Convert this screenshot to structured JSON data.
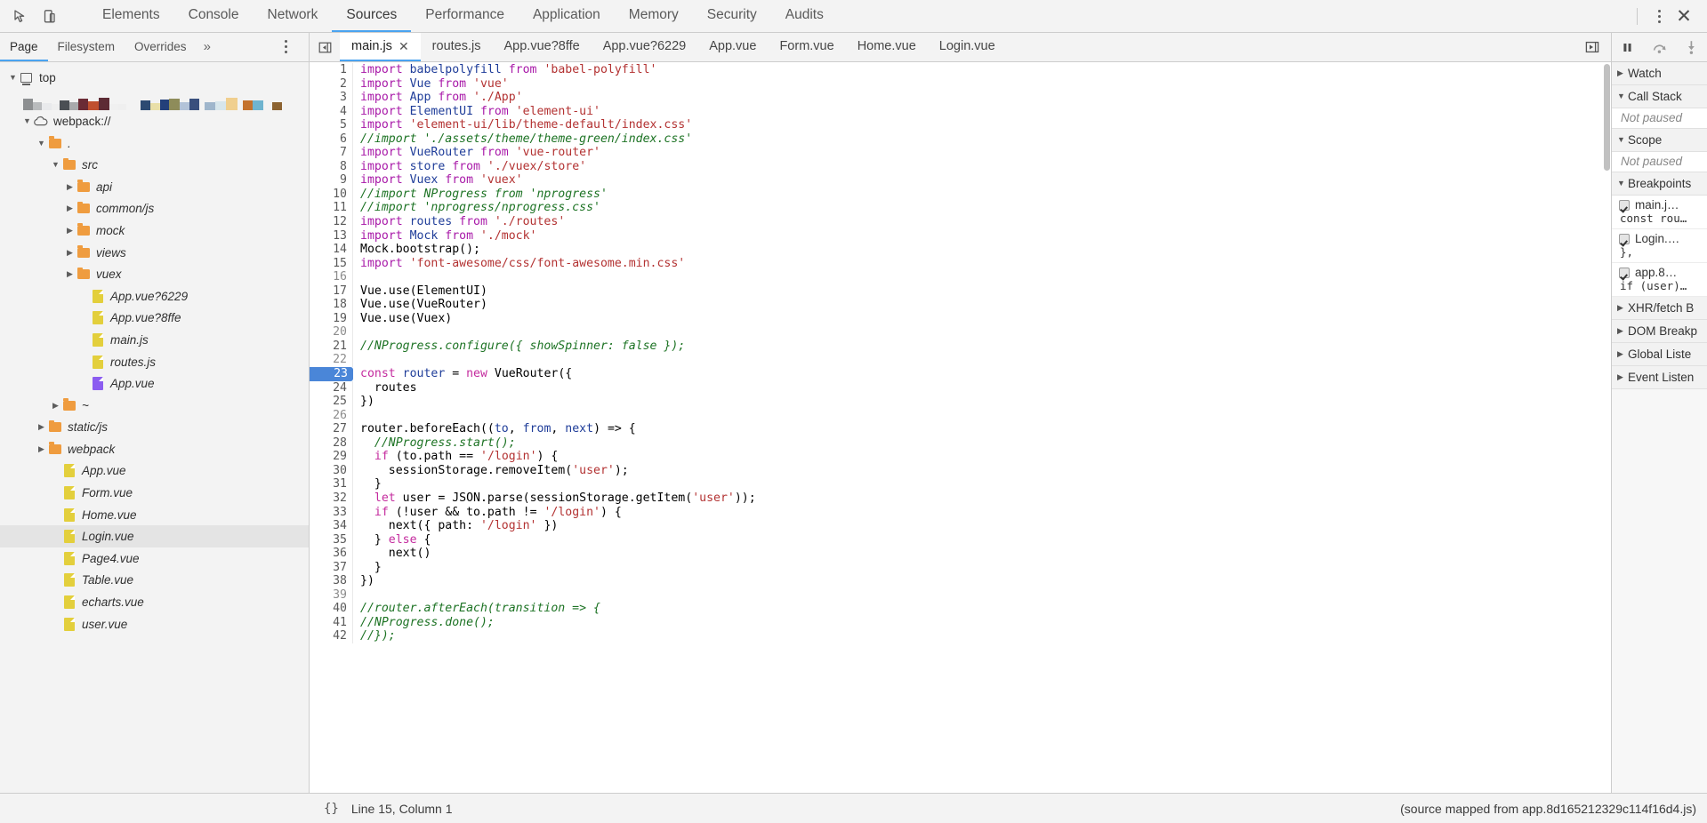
{
  "toolbar": {
    "inspect_icon": "inspect-cursor-icon",
    "device_icon": "device-toggle-icon",
    "tabs": [
      {
        "label": "Elements",
        "active": false
      },
      {
        "label": "Console",
        "active": false
      },
      {
        "label": "Network",
        "active": false
      },
      {
        "label": "Sources",
        "active": true
      },
      {
        "label": "Performance",
        "active": false
      },
      {
        "label": "Application",
        "active": false
      },
      {
        "label": "Memory",
        "active": false
      },
      {
        "label": "Security",
        "active": false
      },
      {
        "label": "Audits",
        "active": false
      }
    ],
    "more_label": "⋮",
    "close_label": "✕"
  },
  "nav_header": {
    "tabs": [
      {
        "label": "Page",
        "active": true
      },
      {
        "label": "Filesystem",
        "active": false
      },
      {
        "label": "Overrides",
        "active": false
      },
      {
        "label": "»",
        "active": false
      }
    ],
    "more_label": "⋮"
  },
  "editor_tabs": [
    {
      "label": "main.js",
      "active": true,
      "closable": true,
      "close_label": "✕"
    },
    {
      "label": "routes.js",
      "active": false,
      "closable": false
    },
    {
      "label": "App.vue?8ffe",
      "active": false,
      "closable": false
    },
    {
      "label": "App.vue?6229",
      "active": false,
      "closable": false
    },
    {
      "label": "App.vue",
      "active": false,
      "closable": false
    },
    {
      "label": "Form.vue",
      "active": false,
      "closable": false
    },
    {
      "label": "Home.vue",
      "active": false,
      "closable": false
    },
    {
      "label": "Login.vue",
      "active": false,
      "closable": false
    }
  ],
  "editor_tabbar_actions": {
    "show_navigator_icon": "show-navigator-icon"
  },
  "debug_toolbar": {
    "pause_icon": "pause-resume-icon",
    "step_over_icon": "step-over-icon",
    "step_into_icon": "step-into-icon"
  },
  "sidebar": {
    "items": [
      {
        "label": "top",
        "icon": "frame-icon",
        "twisty": "▼",
        "indent": 0,
        "italic": false,
        "selected": false
      },
      {
        "label": "",
        "icon": "favicon-mosaic",
        "twisty": "",
        "indent": 1,
        "italic": false,
        "selected": false,
        "mosaic": true
      },
      {
        "label": "webpack://",
        "icon": "cloud-icon",
        "twisty": "▼",
        "indent": 1,
        "italic": false,
        "selected": false
      },
      {
        "label": ".",
        "icon": "folder-icon",
        "twisty": "▼",
        "indent": 2,
        "italic": true,
        "selected": false
      },
      {
        "label": "src",
        "icon": "folder-icon",
        "twisty": "▼",
        "indent": 3,
        "italic": true,
        "selected": false
      },
      {
        "label": "api",
        "icon": "folder-icon",
        "twisty": "▶",
        "indent": 4,
        "italic": true,
        "selected": false
      },
      {
        "label": "common/js",
        "icon": "folder-icon",
        "twisty": "▶",
        "indent": 4,
        "italic": true,
        "selected": false
      },
      {
        "label": "mock",
        "icon": "folder-icon",
        "twisty": "▶",
        "indent": 4,
        "italic": true,
        "selected": false
      },
      {
        "label": "views",
        "icon": "folder-icon",
        "twisty": "▶",
        "indent": 4,
        "italic": true,
        "selected": false
      },
      {
        "label": "vuex",
        "icon": "folder-icon",
        "twisty": "▶",
        "indent": 4,
        "italic": true,
        "selected": false
      },
      {
        "label": "App.vue?6229",
        "icon": "file-icon",
        "twisty": "",
        "indent": 5,
        "italic": true,
        "selected": false
      },
      {
        "label": "App.vue?8ffe",
        "icon": "file-icon",
        "twisty": "",
        "indent": 5,
        "italic": true,
        "selected": false
      },
      {
        "label": "main.js",
        "icon": "file-icon",
        "twisty": "",
        "indent": 5,
        "italic": true,
        "selected": false
      },
      {
        "label": "routes.js",
        "icon": "file-icon",
        "twisty": "",
        "indent": 5,
        "italic": true,
        "selected": false
      },
      {
        "label": "App.vue",
        "icon": "file-icon-purple",
        "twisty": "",
        "indent": 5,
        "italic": true,
        "selected": false
      },
      {
        "label": "~",
        "icon": "folder-icon",
        "twisty": "▶",
        "indent": 3,
        "italic": true,
        "selected": false
      },
      {
        "label": "static/js",
        "icon": "folder-icon",
        "twisty": "▶",
        "indent": 2,
        "italic": true,
        "selected": false
      },
      {
        "label": "webpack",
        "icon": "folder-icon",
        "twisty": "▶",
        "indent": 2,
        "italic": true,
        "selected": false
      },
      {
        "label": "App.vue",
        "icon": "file-icon",
        "twisty": "",
        "indent": 3,
        "italic": true,
        "selected": false
      },
      {
        "label": "Form.vue",
        "icon": "file-icon",
        "twisty": "",
        "indent": 3,
        "italic": true,
        "selected": false
      },
      {
        "label": "Home.vue",
        "icon": "file-icon",
        "twisty": "",
        "indent": 3,
        "italic": true,
        "selected": false
      },
      {
        "label": "Login.vue",
        "icon": "file-icon",
        "twisty": "",
        "indent": 3,
        "italic": true,
        "selected": true
      },
      {
        "label": "Page4.vue",
        "icon": "file-icon",
        "twisty": "",
        "indent": 3,
        "italic": true,
        "selected": false
      },
      {
        "label": "Table.vue",
        "icon": "file-icon",
        "twisty": "",
        "indent": 3,
        "italic": true,
        "selected": false
      },
      {
        "label": "echarts.vue",
        "icon": "file-icon",
        "twisty": "",
        "indent": 3,
        "italic": true,
        "selected": false
      },
      {
        "label": "user.vue",
        "icon": "file-icon",
        "twisty": "",
        "indent": 3,
        "italic": true,
        "selected": false
      }
    ],
    "mosaic_colors": [
      "#8d8f91",
      "#b9bbbd",
      "#e9eaec",
      "#efefef",
      "#4b4f54",
      "#a9aaac",
      "#6b2b35",
      "#c0502f",
      "#5d2b34",
      "#f0f0f0",
      "#efefef",
      "#2c4a72",
      "#e9dfa8",
      "#23407a",
      "#8e8c5a",
      "#b3c3d8",
      "#3a4f7d",
      "#9fb6cc",
      "#d7e6ec",
      "#f0cf8e",
      "#c4722d",
      "#6fb4cf",
      "#8c6331"
    ]
  },
  "code": {
    "file": "main.js",
    "breakpoint_line": 23,
    "lines": [
      {
        "n": 1,
        "tokens": [
          [
            "kw",
            "import "
          ],
          [
            "id",
            "babelpolyfill"
          ],
          [
            "kw",
            " from "
          ],
          [
            "str",
            "'babel-polyfill'"
          ]
        ]
      },
      {
        "n": 2,
        "tokens": [
          [
            "kw",
            "import "
          ],
          [
            "id",
            "Vue"
          ],
          [
            "kw",
            " from "
          ],
          [
            "str",
            "'vue'"
          ]
        ]
      },
      {
        "n": 3,
        "tokens": [
          [
            "kw",
            "import "
          ],
          [
            "id",
            "App"
          ],
          [
            "kw",
            " from "
          ],
          [
            "str",
            "'./App'"
          ]
        ]
      },
      {
        "n": 4,
        "tokens": [
          [
            "kw",
            "import "
          ],
          [
            "id",
            "ElementUI"
          ],
          [
            "kw",
            " from "
          ],
          [
            "str",
            "'element-ui'"
          ]
        ]
      },
      {
        "n": 5,
        "tokens": [
          [
            "kw",
            "import "
          ],
          [
            "str",
            "'element-ui/lib/theme-default/index.css'"
          ]
        ]
      },
      {
        "n": 6,
        "tokens": [
          [
            "com",
            "//import './assets/theme/theme-green/index.css'"
          ]
        ]
      },
      {
        "n": 7,
        "tokens": [
          [
            "kw",
            "import "
          ],
          [
            "id",
            "VueRouter"
          ],
          [
            "kw",
            " from "
          ],
          [
            "str",
            "'vue-router'"
          ]
        ]
      },
      {
        "n": 8,
        "tokens": [
          [
            "kw",
            "import "
          ],
          [
            "id",
            "store"
          ],
          [
            "kw",
            " from "
          ],
          [
            "str",
            "'./vuex/store'"
          ]
        ]
      },
      {
        "n": 9,
        "tokens": [
          [
            "kw",
            "import "
          ],
          [
            "id",
            "Vuex"
          ],
          [
            "kw",
            " from "
          ],
          [
            "str",
            "'vuex'"
          ]
        ]
      },
      {
        "n": 10,
        "tokens": [
          [
            "com",
            "//import NProgress from 'nprogress'"
          ]
        ]
      },
      {
        "n": 11,
        "tokens": [
          [
            "com",
            "//import 'nprogress/nprogress.css'"
          ]
        ]
      },
      {
        "n": 12,
        "tokens": [
          [
            "kw",
            "import "
          ],
          [
            "id",
            "routes"
          ],
          [
            "kw",
            " from "
          ],
          [
            "str",
            "'./routes'"
          ]
        ]
      },
      {
        "n": 13,
        "tokens": [
          [
            "kw",
            "import "
          ],
          [
            "id",
            "Mock"
          ],
          [
            "kw",
            " from "
          ],
          [
            "str",
            "'./mock'"
          ]
        ]
      },
      {
        "n": 14,
        "tokens": [
          [
            "pl",
            "Mock.bootstrap();"
          ]
        ]
      },
      {
        "n": 15,
        "tokens": [
          [
            "kw",
            "import "
          ],
          [
            "str",
            "'font-awesome/css/font-awesome.min.css'"
          ]
        ]
      },
      {
        "n": 16,
        "tokens": []
      },
      {
        "n": 17,
        "tokens": [
          [
            "pl",
            "Vue.use(ElementUI)"
          ]
        ]
      },
      {
        "n": 18,
        "tokens": [
          [
            "pl",
            "Vue.use(VueRouter)"
          ]
        ]
      },
      {
        "n": 19,
        "tokens": [
          [
            "pl",
            "Vue.use(Vuex)"
          ]
        ]
      },
      {
        "n": 20,
        "tokens": []
      },
      {
        "n": 21,
        "tokens": [
          [
            "com",
            "//NProgress.configure({ showSpinner: false });"
          ]
        ]
      },
      {
        "n": 22,
        "tokens": []
      },
      {
        "n": 23,
        "tokens": [
          [
            "kw2",
            "const "
          ],
          [
            "id",
            "router"
          ],
          [
            "pl",
            " = "
          ],
          [
            "kw2",
            "new "
          ],
          [
            "pl",
            "VueRouter({"
          ]
        ]
      },
      {
        "n": 24,
        "tokens": [
          [
            "pl",
            "  routes"
          ]
        ]
      },
      {
        "n": 25,
        "tokens": [
          [
            "pl",
            "})"
          ]
        ]
      },
      {
        "n": 26,
        "tokens": []
      },
      {
        "n": 27,
        "tokens": [
          [
            "pl",
            "router.beforeEach(("
          ],
          [
            "id",
            "to"
          ],
          [
            "pl",
            ", "
          ],
          [
            "id",
            "from"
          ],
          [
            "pl",
            ", "
          ],
          [
            "id",
            "next"
          ],
          [
            "pl",
            ") => {"
          ]
        ]
      },
      {
        "n": 28,
        "tokens": [
          [
            "com",
            "  //NProgress.start();"
          ]
        ]
      },
      {
        "n": 29,
        "tokens": [
          [
            "pl",
            "  "
          ],
          [
            "kw2",
            "if"
          ],
          [
            "pl",
            " (to.path == "
          ],
          [
            "str",
            "'/login'"
          ],
          [
            "pl",
            ") {"
          ]
        ]
      },
      {
        "n": 30,
        "tokens": [
          [
            "pl",
            "    sessionStorage.removeItem("
          ],
          [
            "str",
            "'user'"
          ],
          [
            "pl",
            ");"
          ]
        ]
      },
      {
        "n": 31,
        "tokens": [
          [
            "pl",
            "  }"
          ]
        ]
      },
      {
        "n": 32,
        "tokens": [
          [
            "pl",
            "  "
          ],
          [
            "kw2",
            "let"
          ],
          [
            "pl",
            " user = JSON.parse(sessionStorage.getItem("
          ],
          [
            "str",
            "'user'"
          ],
          [
            "pl",
            "));"
          ]
        ]
      },
      {
        "n": 33,
        "tokens": [
          [
            "pl",
            "  "
          ],
          [
            "kw2",
            "if"
          ],
          [
            "pl",
            " (!user && to.path != "
          ],
          [
            "str",
            "'/login'"
          ],
          [
            "pl",
            ") {"
          ]
        ]
      },
      {
        "n": 34,
        "tokens": [
          [
            "pl",
            "    next({ path: "
          ],
          [
            "str",
            "'/login'"
          ],
          [
            "pl",
            " })"
          ]
        ]
      },
      {
        "n": 35,
        "tokens": [
          [
            "pl",
            "  } "
          ],
          [
            "kw2",
            "else"
          ],
          [
            "pl",
            " {"
          ]
        ]
      },
      {
        "n": 36,
        "tokens": [
          [
            "pl",
            "    next()"
          ]
        ]
      },
      {
        "n": 37,
        "tokens": [
          [
            "pl",
            "  }"
          ]
        ]
      },
      {
        "n": 38,
        "tokens": [
          [
            "pl",
            "})"
          ]
        ]
      },
      {
        "n": 39,
        "tokens": []
      },
      {
        "n": 40,
        "tokens": [
          [
            "com",
            "//router.afterEach(transition => {"
          ]
        ]
      },
      {
        "n": 41,
        "tokens": [
          [
            "com",
            "//NProgress.done();"
          ]
        ]
      },
      {
        "n": 42,
        "tokens": [
          [
            "com",
            "//});"
          ]
        ]
      }
    ]
  },
  "debugger_panel": {
    "sections": [
      {
        "title": "Watch",
        "twisty": "▶",
        "expanded": false,
        "body": null
      },
      {
        "title": "Call Stack",
        "twisty": "▼",
        "expanded": true,
        "body": "Not paused"
      },
      {
        "title": "Scope",
        "twisty": "▼",
        "expanded": true,
        "body": "Not paused"
      },
      {
        "title": "Breakpoints",
        "twisty": "▼",
        "expanded": true,
        "body": null
      },
      {
        "title": "XHR/fetch B",
        "twisty": "▶",
        "expanded": false,
        "body": null
      },
      {
        "title": "DOM Breakp",
        "twisty": "▶",
        "expanded": false,
        "body": null
      },
      {
        "title": "Global Liste",
        "twisty": "▶",
        "expanded": false,
        "body": null
      },
      {
        "title": "Event Listen",
        "twisty": "▶",
        "expanded": false,
        "body": null
      }
    ],
    "breakpoints": [
      {
        "checked": true,
        "file": "main.j…",
        "snippet": "const rou…"
      },
      {
        "checked": true,
        "file": "Login.…",
        "snippet": "},"
      },
      {
        "checked": true,
        "file": "app.8…",
        "snippet": "if (user)…"
      }
    ]
  },
  "statusbar": {
    "format_label": "{}",
    "position": "Line 15, Column 1",
    "source_map": "(source mapped from app.8d165212329c114f16d4.js)"
  }
}
